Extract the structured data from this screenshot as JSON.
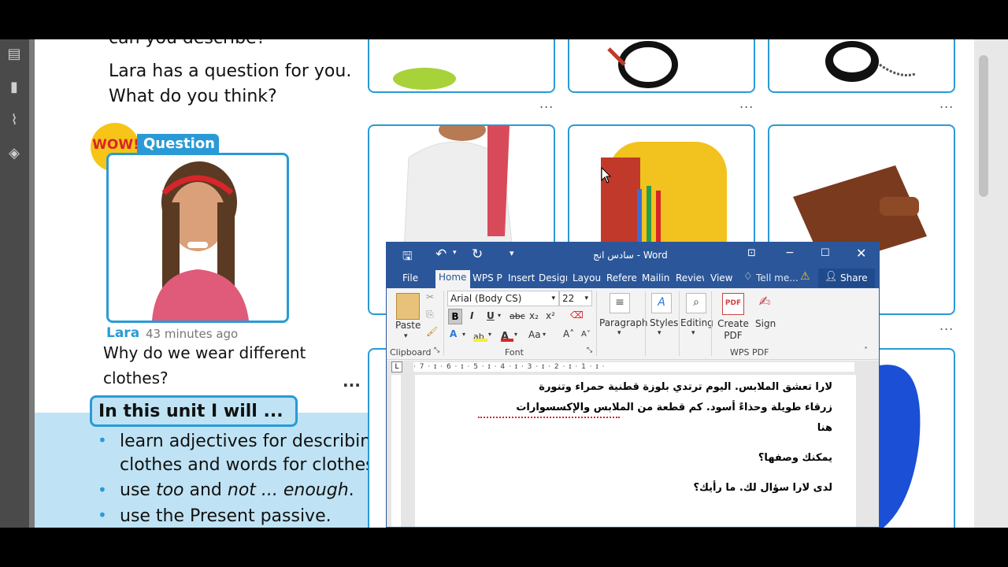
{
  "book": {
    "line_top_partial": "can you describe?",
    "line_q1": "Lara has a question for you.",
    "line_q2": "What do you think?",
    "wow_badge": "WOW!",
    "question_tag": "Question",
    "post_author": "Lara",
    "post_time": "43 minutes ago",
    "post_text1": "Why do we wear different",
    "post_text2": "clothes?",
    "more_dots": "...",
    "unit_heading": "In this unit I will ...",
    "bullets": [
      {
        "line1": "learn adjectives for describing",
        "line2": "clothes and words for clothes"
      },
      {
        "pre": "use ",
        "em1": "too",
        "mid": " and ",
        "em2": "not ... enough",
        "post": "."
      },
      {
        "line1": "use the Present passive."
      }
    ],
    "card_dots": "..."
  },
  "word": {
    "title": "سادس انج - Word",
    "tabs": [
      "File",
      "Home",
      "WPS PI",
      "Insert",
      "Design",
      "Layout",
      "Referer",
      "Mailin",
      "Review",
      "View"
    ],
    "tell_me": "Tell me...",
    "share": "Share",
    "font_name": "Arial (Body CS)",
    "font_size": "22",
    "groups": {
      "clipboard": "Clipboard",
      "font": "Font",
      "paragraph": "Paragraph",
      "styles": "Styles",
      "editing": "Editing",
      "create_pdf": "Create PDF",
      "sign": "Sign",
      "wps_pdf": "WPS PDF",
      "paste": "Paste"
    },
    "format_buttons": {
      "bold": "B",
      "italic": "I",
      "underline": "U",
      "strike": "abc",
      "sub": "x₂",
      "sup": "x²",
      "aa": "Aa"
    },
    "ruler_text": "· 7 · ɪ · 6 · ɪ · 5 · ɪ · 4 · ɪ · 3 · ɪ · 2 · ɪ · 1 · ɪ · ",
    "doc_lines": [
      "لارا تعشق الملابس. اليوم ترتدي بلوزة قطنية حمراء وتنورة",
      "زرقاء طويلة وحذاءً أسود. كم قطعة من الملابس والإكسسوارات",
      "هنا",
      "يمكنك وصفها؟",
      "لدى لارا سؤال لك. ما رأيك؟"
    ]
  },
  "colors": {
    "word_blue": "#2b579a",
    "book_blue": "#2a9ad6",
    "light_blue_panel": "#bfe3f4"
  }
}
